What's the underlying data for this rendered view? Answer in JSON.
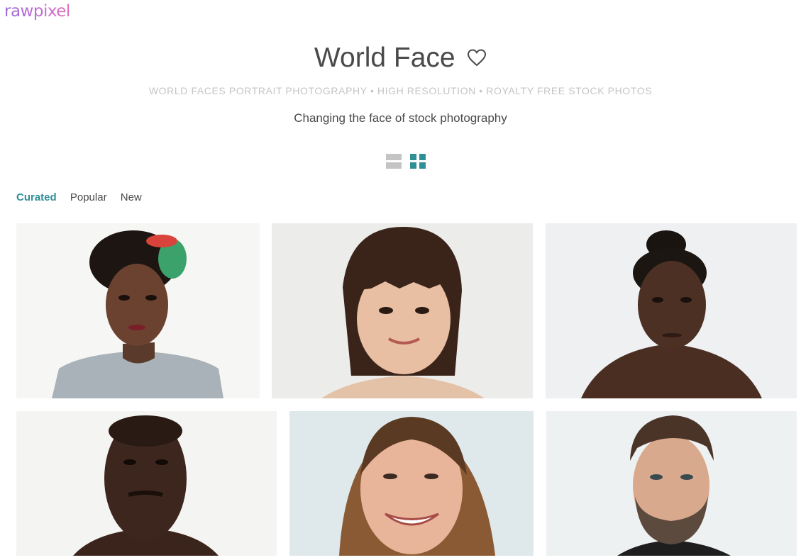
{
  "brand": {
    "logo_text": "rawpixel"
  },
  "header": {
    "title": "World Face",
    "tagline": "WORLD FACES PORTRAIT PHOTOGRAPHY • HIGH RESOLUTION • ROYALTY FREE STOCK PHOTOS",
    "subtitle": "Changing the face of stock photography"
  },
  "view_toggle": {
    "options": [
      {
        "name": "list-view-icon",
        "active": false
      },
      {
        "name": "grid-view-icon",
        "active": true
      }
    ]
  },
  "tabs": [
    {
      "label": "Curated",
      "active": true
    },
    {
      "label": "Popular",
      "active": false
    },
    {
      "label": "New",
      "active": false
    }
  ],
  "colors": {
    "accent": "#2f8f97",
    "text": "#4a4a4a",
    "muted": "#c4c4c4"
  }
}
